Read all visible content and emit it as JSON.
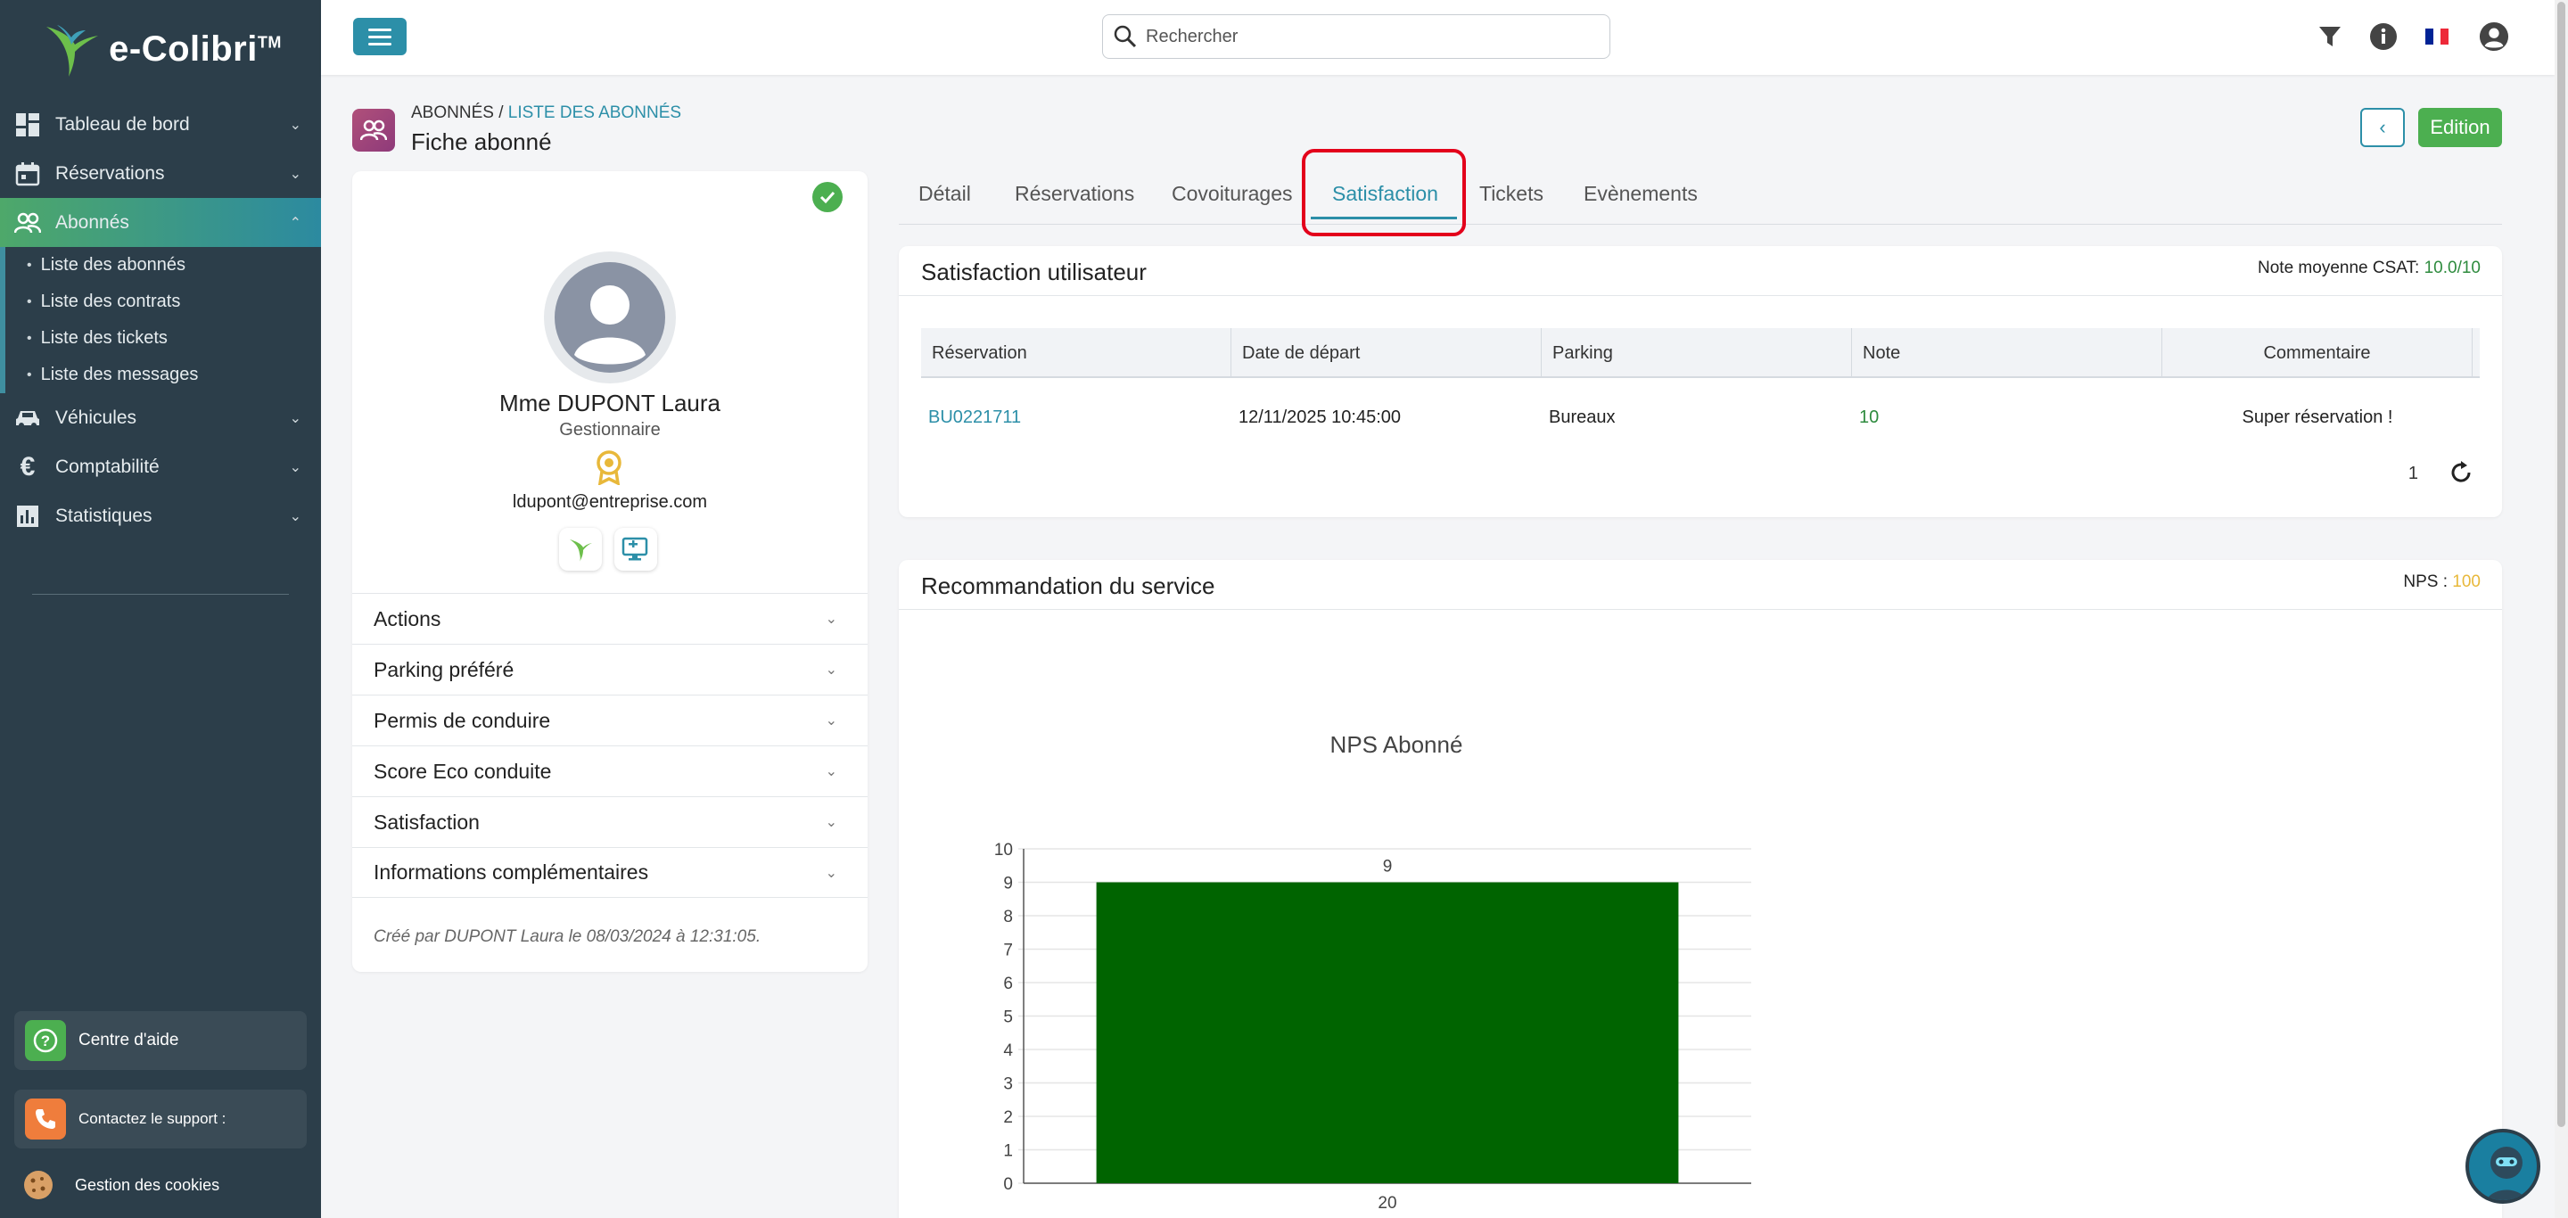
{
  "brand": {
    "name": "e-Colibri",
    "tm": "TM",
    "primary_color": "#2c8fa8",
    "sidebar_color": "#2c3e4a",
    "accent_green": "#4caf50"
  },
  "sidebar": {
    "items": [
      {
        "label": "Tableau de bord",
        "icon": "dashboard-icon"
      },
      {
        "label": "Réservations",
        "icon": "calendar-icon"
      },
      {
        "label": "Abonnés",
        "icon": "users-icon",
        "active": true
      },
      {
        "label": "Véhicules",
        "icon": "car-icon"
      },
      {
        "label": "Comptabilité",
        "icon": "euro-icon"
      },
      {
        "label": "Statistiques",
        "icon": "stats-icon"
      }
    ],
    "subitems": [
      "Liste des abonnés",
      "Liste des contrats",
      "Liste des tickets",
      "Liste des messages"
    ],
    "help": "Centre d'aide",
    "support": "Contactez le support :",
    "cookies": "Gestion des cookies"
  },
  "header": {
    "search_placeholder": "Rechercher"
  },
  "page": {
    "crumb_root": "ABONNÉS /",
    "crumb_link": "LISTE DES ABONNÉS",
    "title": "Fiche abonné",
    "back": "‹",
    "edit": "Edition"
  },
  "profile": {
    "name": "Mme DUPONT Laura",
    "role": "Gestionnaire",
    "email": "ldupont@entreprise.com",
    "sections": [
      "Actions",
      "Parking préféré",
      "Permis de conduire",
      "Score Eco conduite",
      "Satisfaction",
      "Informations complémentaires"
    ],
    "footer": "Créé par DUPONT Laura le 08/03/2024 à 12:31:05."
  },
  "tabs": [
    "Détail",
    "Réservations",
    "Covoiturages",
    "Satisfaction",
    "Tickets",
    "Evènements"
  ],
  "active_tab": "Satisfaction",
  "satisfaction": {
    "title": "Satisfaction utilisateur",
    "meta_label": "Note moyenne CSAT:",
    "meta_value": "10.0/10",
    "columns": [
      "Réservation",
      "Date de départ",
      "Parking",
      "Note",
      "Commentaire"
    ],
    "rows": [
      {
        "reservation": "BU0221711",
        "date": "12/11/2025 10:45:00",
        "parking": "Bureaux",
        "note": "10",
        "comment": "Super réservation !"
      }
    ],
    "page": "1"
  },
  "recommendation": {
    "title": "Recommandation du service",
    "meta_label": "NPS :",
    "meta_value": "100"
  },
  "chart_data": {
    "type": "bar",
    "title": "NPS Abonné",
    "categories": [
      "20"
    ],
    "values": [
      9
    ],
    "data_labels": [
      "9"
    ],
    "ylim": [
      0,
      10
    ],
    "yticks": [
      0,
      1,
      2,
      3,
      4,
      5,
      6,
      7,
      8,
      9,
      10
    ],
    "bar_color": "#006400",
    "grid": true
  }
}
